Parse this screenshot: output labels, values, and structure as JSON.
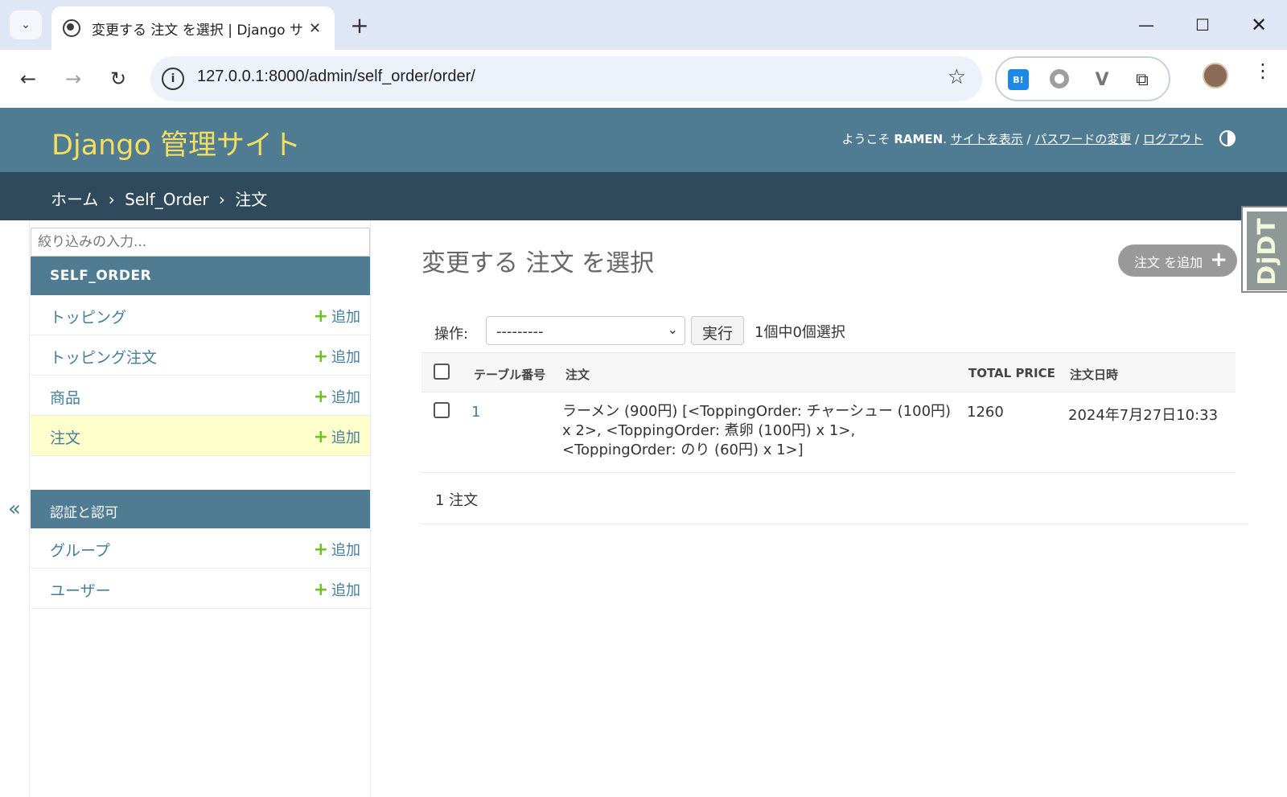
{
  "browser": {
    "tab_title": "変更する 注文 を選択 | Django サイト管理",
    "url": "127.0.0.1:8000/admin/self_order/order/",
    "extensions": [
      "B!"
    ]
  },
  "header": {
    "site_name": "Django 管理サイト",
    "welcome": "ようこそ",
    "username": "RAMEN",
    "view_site": "サイトを表示",
    "password_change": "パスワードの変更",
    "logout": "ログアウト"
  },
  "breadcrumbs": {
    "home": "ホーム",
    "app": "Self_Order",
    "model": "注文",
    "sep": "›"
  },
  "djdt": "DjDT",
  "sidebar": {
    "filter_placeholder": "絞り込みの入力...",
    "collapse": "«",
    "add_label": "追加",
    "modules": [
      {
        "name": "SELF_ORDER",
        "models": [
          {
            "name": "トッピング",
            "current": false
          },
          {
            "name": "トッピング注文",
            "current": false
          },
          {
            "name": "商品",
            "current": false
          },
          {
            "name": "注文",
            "current": true
          }
        ]
      },
      {
        "name": "認証と認可",
        "models": [
          {
            "name": "グループ",
            "current": false
          },
          {
            "name": "ユーザー",
            "current": false
          }
        ]
      }
    ]
  },
  "content": {
    "title": "変更する 注文 を選択",
    "add_button": "注文 を追加",
    "actions": {
      "label": "操作:",
      "selected_option": "---------",
      "go": "実行",
      "counter": "1個中0個選択"
    },
    "table": {
      "columns": [
        "テーブル番号",
        "注文",
        "TOTAL PRICE",
        "注文日時"
      ],
      "rows": [
        {
          "table_number": "1",
          "order": "ラーメン (900円) [<ToppingOrder: チャーシュー (100円) x 2>, <ToppingOrder: 煮卵 (100円) x 1>, <ToppingOrder: のり (60円) x 1>]",
          "total_price": "1260",
          "ordered_at": "2024年7月27日10:33"
        }
      ]
    },
    "paginator": "1 注文"
  },
  "colors": {
    "header_bg": "#507c93",
    "breadcrumb_bg": "#2f4a5c",
    "branding": "#f5dd5d",
    "link": "#447e9b",
    "add_plus": "#70bf2b",
    "current_row": "#ffffcc"
  }
}
